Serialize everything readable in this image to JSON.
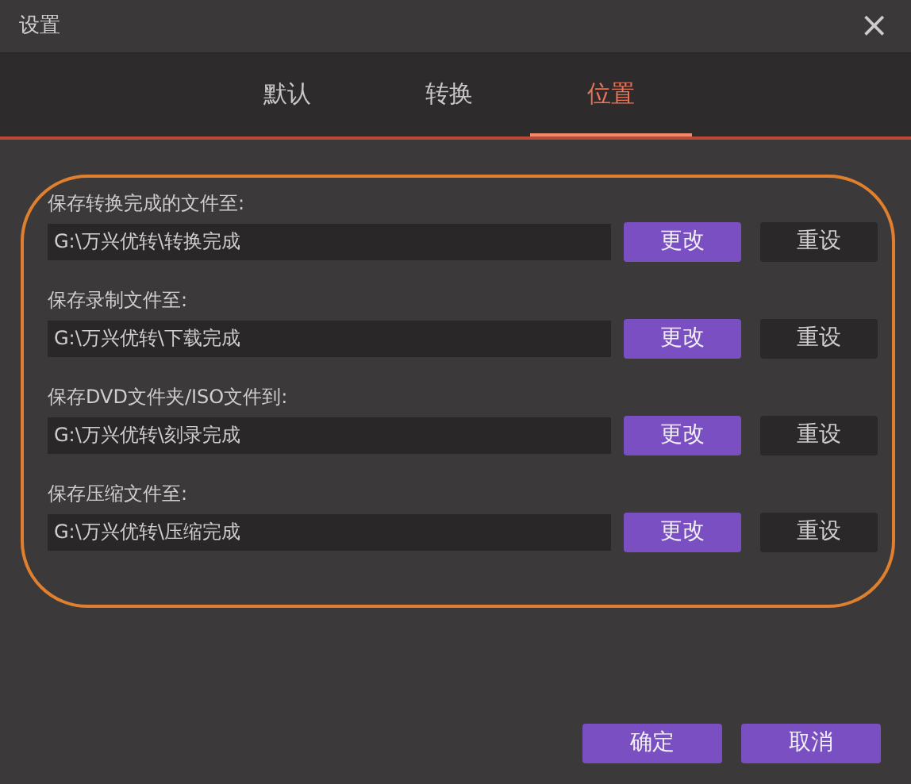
{
  "window": {
    "title": "设置",
    "close": "×"
  },
  "tabs": [
    {
      "label": "默认",
      "selected": false
    },
    {
      "label": "转换",
      "selected": false
    },
    {
      "label": "位置",
      "selected": true
    }
  ],
  "locations": [
    {
      "label": "保存转换完成的文件至:",
      "path": "G:\\万兴优转\\转换完成",
      "change": "更改",
      "reset": "重设"
    },
    {
      "label": "保存录制文件至:",
      "path": "G:\\万兴优转\\下载完成",
      "change": "更改",
      "reset": "重设"
    },
    {
      "label": "保存DVD文件夹/ISO文件到:",
      "path": "G:\\万兴优转\\刻录完成",
      "change": "更改",
      "reset": "重设"
    },
    {
      "label": "保存压缩文件至:",
      "path": "G:\\万兴优转\\压缩完成",
      "change": "更改",
      "reset": "重设"
    }
  ],
  "highlight": true,
  "buttons": [
    "确定",
    "取消"
  ]
}
